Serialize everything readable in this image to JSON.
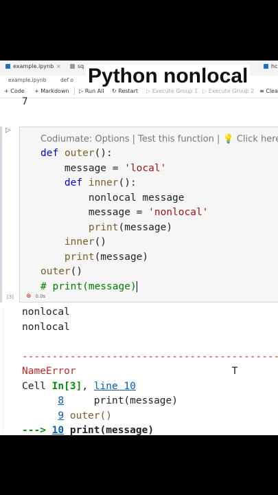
{
  "tabs": [
    {
      "label": "example.ipynb"
    },
    {
      "label": "sq"
    },
    {
      "label": "hc"
    }
  ],
  "breadcrumb": [
    "example.ipynb",
    "def o"
  ],
  "toolbar": {
    "code_label": "+ Code",
    "markdown_label": "+ Markdown",
    "run_all_label": "Run All",
    "restart_label": "Restart",
    "exec_group1_label": "Execute Group 1",
    "exec_group2_label": "Execute Group 2",
    "clear_label": "Clear"
  },
  "video_title": "Python nonlocal",
  "previous_output": "7",
  "cell": {
    "codelens": "Codiumate: Options | Test this function | 💡 Click here to",
    "index": "[3]",
    "exec_time": "0.0s"
  },
  "code_lines": {
    "l1_kw": "def",
    "l1_fn": "outer",
    "l1_rest": "():",
    "l2": "    message = ",
    "l2_str": "'local'",
    "l3_kw": "    def",
    "l3_fn": " inner",
    "l3_rest": "():",
    "l4": "        nonlocal message",
    "l5": "        message = ",
    "l5_str": "'nonlocal'",
    "l6_fn": "        print",
    "l6_rest": "(message)",
    "l7_fn": "    inner",
    "l7_rest": "()",
    "l8_fn": "    print",
    "l8_rest": "(message)",
    "l9_fn": "outer",
    "l9_rest": "()",
    "l10_cm": "# print(message)"
  },
  "output_lines": {
    "o1": "nonlocal",
    "o2": "nonlocal",
    "dashes": "---------------------------------------------",
    "err_name": "NameError",
    "err_trail": "T",
    "cell_prefix": "Cell ",
    "cell_in": "In[3]",
    "cell_sep": ", ",
    "cell_line": "line 10",
    "t1_num": "8",
    "t1_code": "     print(message)",
    "t2_num": "9",
    "t2_code": " outer()",
    "t3_arrow": "---> ",
    "t3_num": "10",
    "t3_code": " print(message)"
  }
}
